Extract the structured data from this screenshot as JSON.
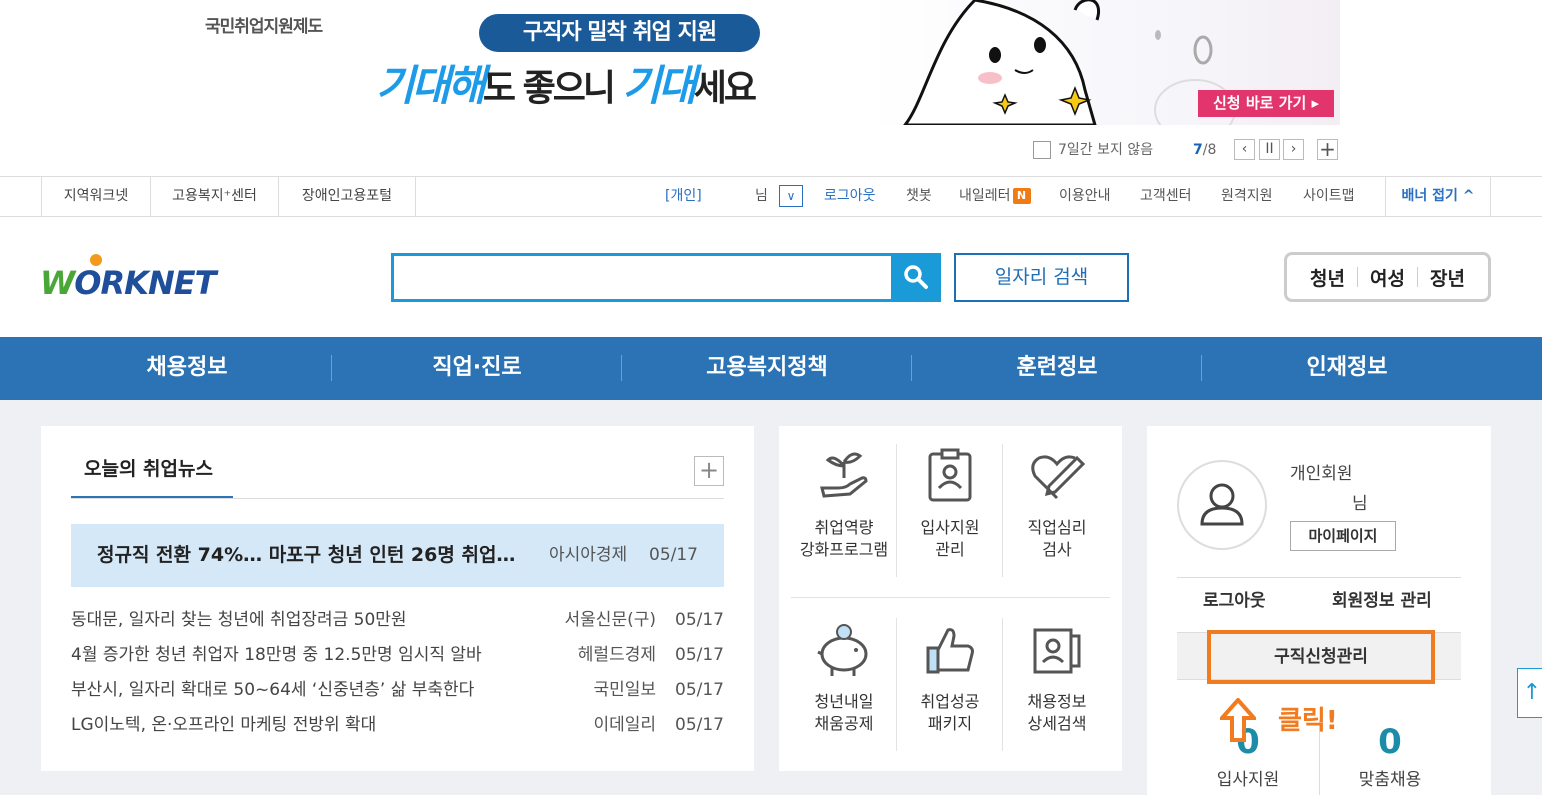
{
  "banner": {
    "small_title": "국민취업지원제도",
    "pill_text": "구직자 밀착 취업 지원",
    "headline_a": "기대해",
    "headline_b": "도 좋으니 ",
    "headline_c": "기대",
    "headline_d": "세요",
    "apply_btn": "신청 바로 가기 ▸",
    "hide_7days": "7일간 보지 않음",
    "page_current": "7",
    "page_total": "/8",
    "prev": "‹",
    "pause": "II",
    "next": "›",
    "add": "+"
  },
  "util": {
    "left_links": [
      "지역워크넷",
      "고용복지⁺센터",
      "장애인고용포털"
    ],
    "member_type": "[개인]",
    "honorific": "님",
    "dropdown": "∨",
    "logout": "로그아웃",
    "chatbot": "챗봇",
    "myletter": "내일레터",
    "new_badge": "N",
    "guide": "이용안내",
    "support": "고객센터",
    "remote": "원격지원",
    "sitemap": "사이트맵",
    "fold_banner": "배너 접기 ^"
  },
  "header": {
    "logo_w": "W",
    "logo_rest": "ORKNET",
    "search_placeholder": "",
    "search_icon": "search-icon",
    "job_search_btn": "일자리 검색",
    "age_tabs": [
      "청년",
      "여성",
      "장년"
    ]
  },
  "gnb": [
    "채용정보",
    "직업·진로",
    "고용복지정책",
    "훈련정보",
    "인재정보"
  ],
  "news": {
    "tab_label": "오늘의 취업뉴스",
    "more": "+",
    "headline": {
      "title": "정규직 전환 74%… 마포구 청년 인턴 26명 취업…",
      "source": "아시아경제",
      "date": "05/17"
    },
    "items": [
      {
        "title": "동대문, 일자리 찾는 청년에 취업장려금 50만원",
        "source": "서울신문(구)",
        "date": "05/17"
      },
      {
        "title": "4월 증가한 청년 취업자 18만명 중 12.5만명 임시직 알바",
        "source": "헤럴드경제",
        "date": "05/17"
      },
      {
        "title": "부산시, 일자리 확대로 50~64세 ‘신중년층’ 삶 부축한다",
        "source": "국민일보",
        "date": "05/17"
      },
      {
        "title": "LG이노텍, 온·오프라인 마케팅 전방위 확대",
        "source": "이데일리",
        "date": "05/17"
      }
    ]
  },
  "quick": [
    {
      "line1": "취업역량",
      "line2": "강화프로그램",
      "icon": "sprout-hand-icon"
    },
    {
      "line1": "입사지원",
      "line2": "관리",
      "icon": "id-card-icon"
    },
    {
      "line1": "직업심리",
      "line2": "검사",
      "icon": "heart-pen-icon"
    },
    {
      "line1": "청년내일",
      "line2": "채움공제",
      "icon": "piggy-bank-icon"
    },
    {
      "line1": "취업성공",
      "line2": "패키지",
      "icon": "thumbs-up-icon"
    },
    {
      "line1": "채용정보",
      "line2": "상세검색",
      "icon": "search-doc-icon"
    }
  ],
  "user": {
    "member_label": "개인회원",
    "honorific": "님",
    "mypage": "마이페이지",
    "logout": "로그아웃",
    "profile_manage": "회원정보 관리",
    "apply_manage": "구직신청관리",
    "click_note": "클릭!",
    "stats": [
      {
        "value": "0",
        "label": "입사지원"
      },
      {
        "value": "0",
        "label": "맞춤채용"
      }
    ]
  },
  "colors": {
    "brand_blue": "#2b73b5",
    "accent_orange": "#f07b20",
    "search_blue": "#1a9ad6"
  }
}
